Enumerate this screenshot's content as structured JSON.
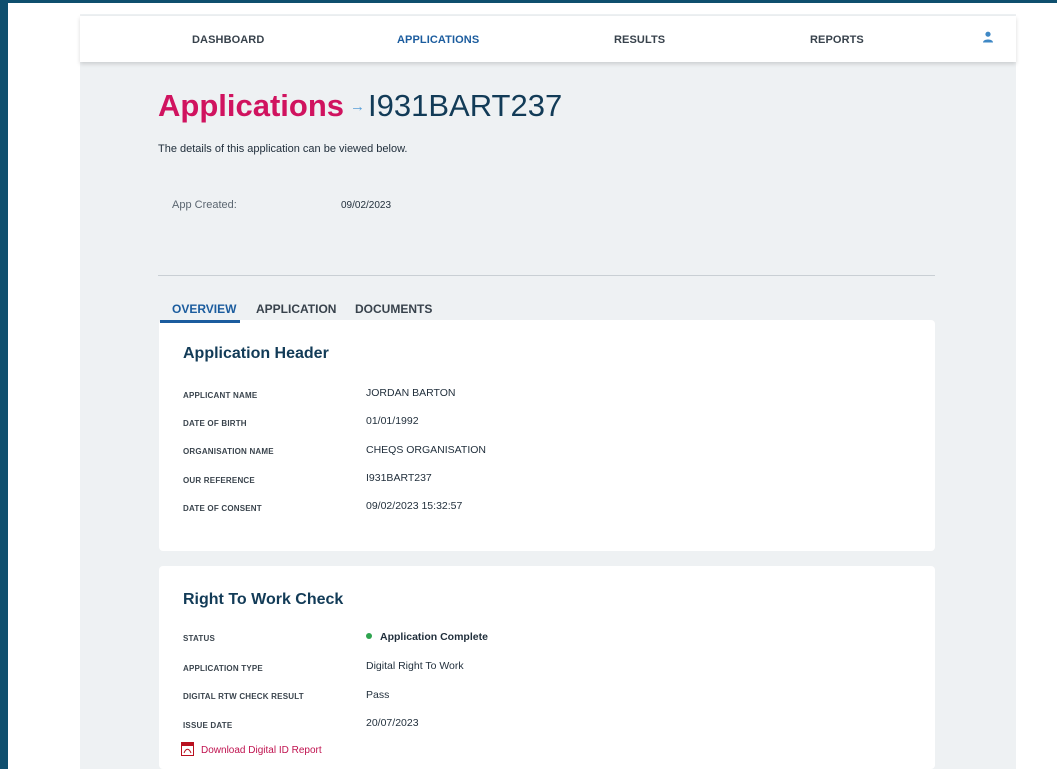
{
  "nav": {
    "items": [
      "DASHBOARD",
      "APPLICATIONS",
      "RESULTS",
      "REPORTS"
    ],
    "active": "APPLICATIONS",
    "user_icon": "user-icon"
  },
  "page": {
    "title": "Applications",
    "arrow": "→",
    "reference": "I931BART237",
    "subtitle": "The details of this application can be viewed below.",
    "created_label": "App Created:",
    "created_value": "09/02/2023"
  },
  "tabs": [
    "OVERVIEW",
    "APPLICATION",
    "DOCUMENTS"
  ],
  "active_tab": "OVERVIEW",
  "application_header": {
    "title": "Application Header",
    "rows": [
      {
        "label": "APPLICANT NAME",
        "value": "JORDAN BARTON"
      },
      {
        "label": "DATE OF BIRTH",
        "value": "01/01/1992"
      },
      {
        "label": "ORGANISATION NAME",
        "value": "CHEQS ORGANISATION"
      },
      {
        "label": "OUR REFERENCE",
        "value": "I931BART237"
      },
      {
        "label": "DATE OF CONSENT",
        "value": "09/02/2023 15:32:57"
      }
    ]
  },
  "right_to_work": {
    "title": "Right To Work Check",
    "rows": [
      {
        "label": "STATUS",
        "value": "Application Complete"
      },
      {
        "label": "APPLICATION TYPE",
        "value": "Digital Right To Work"
      },
      {
        "label": "DIGITAL RTW CHECK RESULT",
        "value": "Pass"
      },
      {
        "label": "ISSUE DATE",
        "value": "20/07/2023"
      }
    ],
    "download_label": "Download Digital ID Report",
    "download_icon": "pdf-icon"
  },
  "colors": {
    "brand_pink": "#d0135f",
    "nav_active": "#1b5c9e",
    "status_green": "#2ea44f",
    "frame": "#0f4f6e"
  }
}
